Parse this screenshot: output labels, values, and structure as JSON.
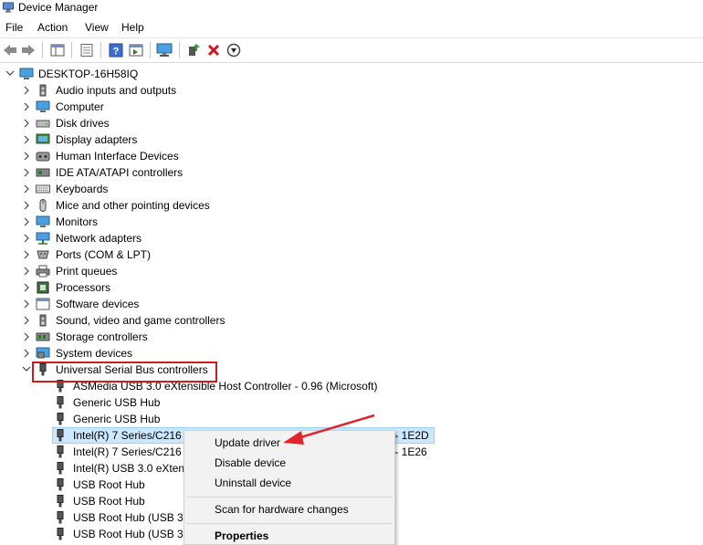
{
  "window": {
    "title": "Device Manager"
  },
  "menu": [
    "File",
    "Action",
    "View",
    "Help"
  ],
  "tree": {
    "root": "DESKTOP-16H58IQ",
    "categories": [
      "Audio inputs and outputs",
      "Computer",
      "Disk drives",
      "Display adapters",
      "Human Interface Devices",
      "IDE ATA/ATAPI controllers",
      "Keyboards",
      "Mice and other pointing devices",
      "Monitors",
      "Network adapters",
      "Ports (COM & LPT)",
      "Print queues",
      "Processors",
      "Software devices",
      "Sound, video and game controllers",
      "Storage controllers",
      "System devices",
      "Universal Serial Bus controllers"
    ],
    "usb_children": [
      "ASMedia USB 3.0 eXtensible Host Controller - 0.96 (Microsoft)",
      "Generic USB Hub",
      "Generic USB Hub",
      "Intel(R) 7 Series/C216 C",
      "Intel(R) 7 Series/C216 C",
      "Intel(R) USB 3.0 eXtensi",
      "USB Root Hub",
      "USB Root Hub",
      "USB Root Hub (USB 3.0",
      "USB Root Hub (USB 3.0"
    ],
    "row_tails": {
      "intel_1": "r - 1E2D",
      "intel_2": "r - 1E26"
    }
  },
  "context_menu": {
    "update_driver": "Update driver",
    "disable_device": "Disable device",
    "uninstall_device": "Uninstall device",
    "scan_hardware": "Scan for hardware changes",
    "properties": "Properties"
  },
  "colors": {
    "selection": "#cce8ff",
    "highlight_box": "#d11a1a",
    "arrow": "#e0262c",
    "menu_bg": "#f2f2f2"
  }
}
